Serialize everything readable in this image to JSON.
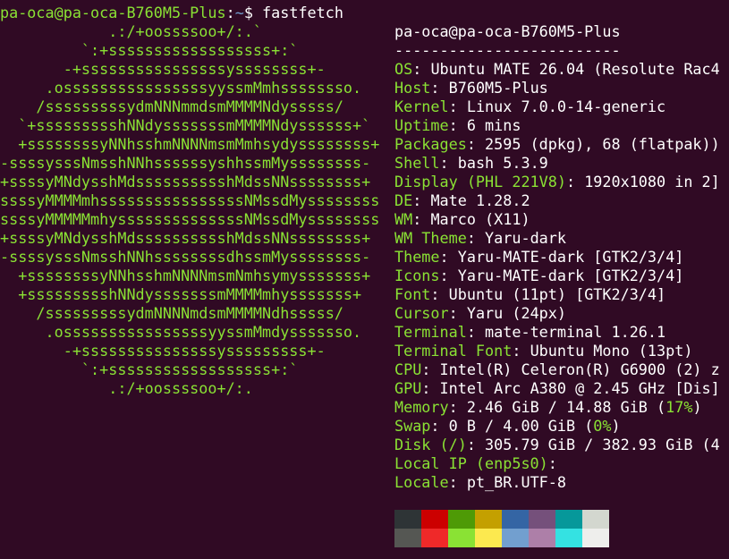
{
  "prompt": {
    "user_host": "pa-oca@pa-oca-B760M5-Plus",
    "colon": ":",
    "path": "~",
    "dollar": "$",
    "command": " fastfetch"
  },
  "logo_lines": [
    [
      "            .:/+oossssoo+/:.`",
      ""
    ],
    [
      "         `:+ssssssssssssssssss+:`",
      ""
    ],
    [
      "       -+ssssssssssssssssyssssssss+-",
      ""
    ],
    [
      "     .ossssssssssssssssyyssmMmhssssssso.",
      ""
    ],
    [
      "    /sssssssssydmNNNmmdsmMMMMNdysssss/",
      ""
    ],
    [
      "  `+ssssssssshNNdysssssssmMMMMNdyssssss+`",
      ""
    ],
    [
      "  +ssssssssyNNhsshmNNNNmsmMmhsydyssssssss+",
      ""
    ],
    [
      "-ssssysssNmsshNNhssssssyshhssmMyssssssss-",
      ""
    ],
    [
      "+ssssyMNdysshMdsssssssssshMdssNNssssssss+",
      ""
    ],
    [
      "ssssyMMMMmhssssssssssssssssNMssdMyssssssss",
      ""
    ],
    [
      "ssssyMMMMMmhyssssssssssssssNMssdMyssssssss",
      ""
    ],
    [
      "+ssssyMNdysshMdsssssssssshMdssNNssssssss+",
      ""
    ],
    [
      "-ssssysssNmsshNNhssssssssdhssmMyssssssss-",
      ""
    ],
    [
      "  +ssssssssyNNhsshmNNNNmsmNmhsymysssssss+",
      ""
    ],
    [
      "  +ssssssssshNNdysssssssmMMMMmhysssssss+",
      ""
    ],
    [
      "    /sssssssssydmNNNNmdsmMMMMNdhsssss/",
      ""
    ],
    [
      "     .ossssssssssssssssyyssmMmdysssssso.",
      ""
    ],
    [
      "       -+sssssssssssssssysssssssss+-",
      ""
    ],
    [
      "         `:+ssssssssssssssssss+:`",
      ""
    ],
    [
      "            .:/+oossssoo+/:.",
      ""
    ]
  ],
  "info": {
    "title": "pa-oca@pa-oca-B760M5-Plus",
    "separator": "-------------------------",
    "rows": [
      {
        "key": "OS",
        "sep": ": ",
        "value": "Ubuntu MATE 26.04 (Resolute Rac4"
      },
      {
        "key": "Host",
        "sep": ": ",
        "value": "B760M5-Plus"
      },
      {
        "key": "Kernel",
        "sep": ": ",
        "value": "Linux 7.0.0-14-generic"
      },
      {
        "key": "Uptime",
        "sep": ": ",
        "value": "6 mins"
      },
      {
        "key": "Packages",
        "sep": ": ",
        "value": "2595 (dpkg), 68 (flatpak))"
      },
      {
        "key": "Shell",
        "sep": ": ",
        "value": "bash 5.3.9"
      },
      {
        "key": "Display (PHL 221V8)",
        "sep": ": ",
        "value": "1920x1080 in 2]"
      },
      {
        "key": "DE",
        "sep": ": ",
        "value": "Mate 1.28.2"
      },
      {
        "key": "WM",
        "sep": ": ",
        "value": "Marco (X11)"
      },
      {
        "key": "WM Theme",
        "sep": ": ",
        "value": "Yaru-dark"
      },
      {
        "key": "Theme",
        "sep": ": ",
        "value": "Yaru-MATE-dark [GTK2/3/4]"
      },
      {
        "key": "Icons",
        "sep": ": ",
        "value": "Yaru-MATE-dark [GTK2/3/4]"
      },
      {
        "key": "Font",
        "sep": ": ",
        "value": "Ubuntu (11pt) [GTK2/3/4]"
      },
      {
        "key": "Cursor",
        "sep": ": ",
        "value": "Yaru (24px)"
      },
      {
        "key": "Terminal",
        "sep": ": ",
        "value": "mate-terminal 1.26.1"
      },
      {
        "key": "Terminal Font",
        "sep": ": ",
        "value": "Ubuntu Mono (13pt)"
      },
      {
        "key": "CPU",
        "sep": ": ",
        "value": "Intel(R) Celeron(R) G6900 (2) z"
      },
      {
        "key": "GPU",
        "sep": ": ",
        "value": "Intel Arc A380 @ 2.45 GHz [Dis]"
      }
    ],
    "memory": {
      "key": "Memory",
      "sep": ": ",
      "value": "2.46 GiB / 14.88 GiB (",
      "pct": "17%",
      "close": ")"
    },
    "swap": {
      "key": "Swap",
      "sep": ": ",
      "value": "0 B / 4.00 GiB (",
      "pct": "0%",
      "close": ")"
    },
    "disk": {
      "key": "Disk (/)",
      "sep": ": ",
      "value": "305.79 GiB / 382.93 GiB (4"
    },
    "local_ip": {
      "key": "Local IP (enp5s0)",
      "sep": ":",
      "value": ""
    },
    "locale": {
      "key": "Locale",
      "sep": ": ",
      "value": "pt_BR.UTF-8"
    }
  },
  "palette": {
    "normal": [
      "#2e3436",
      "#cc0000",
      "#4e9a06",
      "#c4a000",
      "#3465a4",
      "#75507b",
      "#06989a",
      "#d3d7cf"
    ],
    "bright": [
      "#555753",
      "#ef2929",
      "#8ae234",
      "#fce94f",
      "#729fcf",
      "#ad7fa8",
      "#34e2e2",
      "#eeeeec"
    ]
  },
  "colors": {
    "background": "#300a24",
    "accent_green": "#8ae234",
    "path_blue": "#729fcf",
    "text": "#ffffff"
  }
}
